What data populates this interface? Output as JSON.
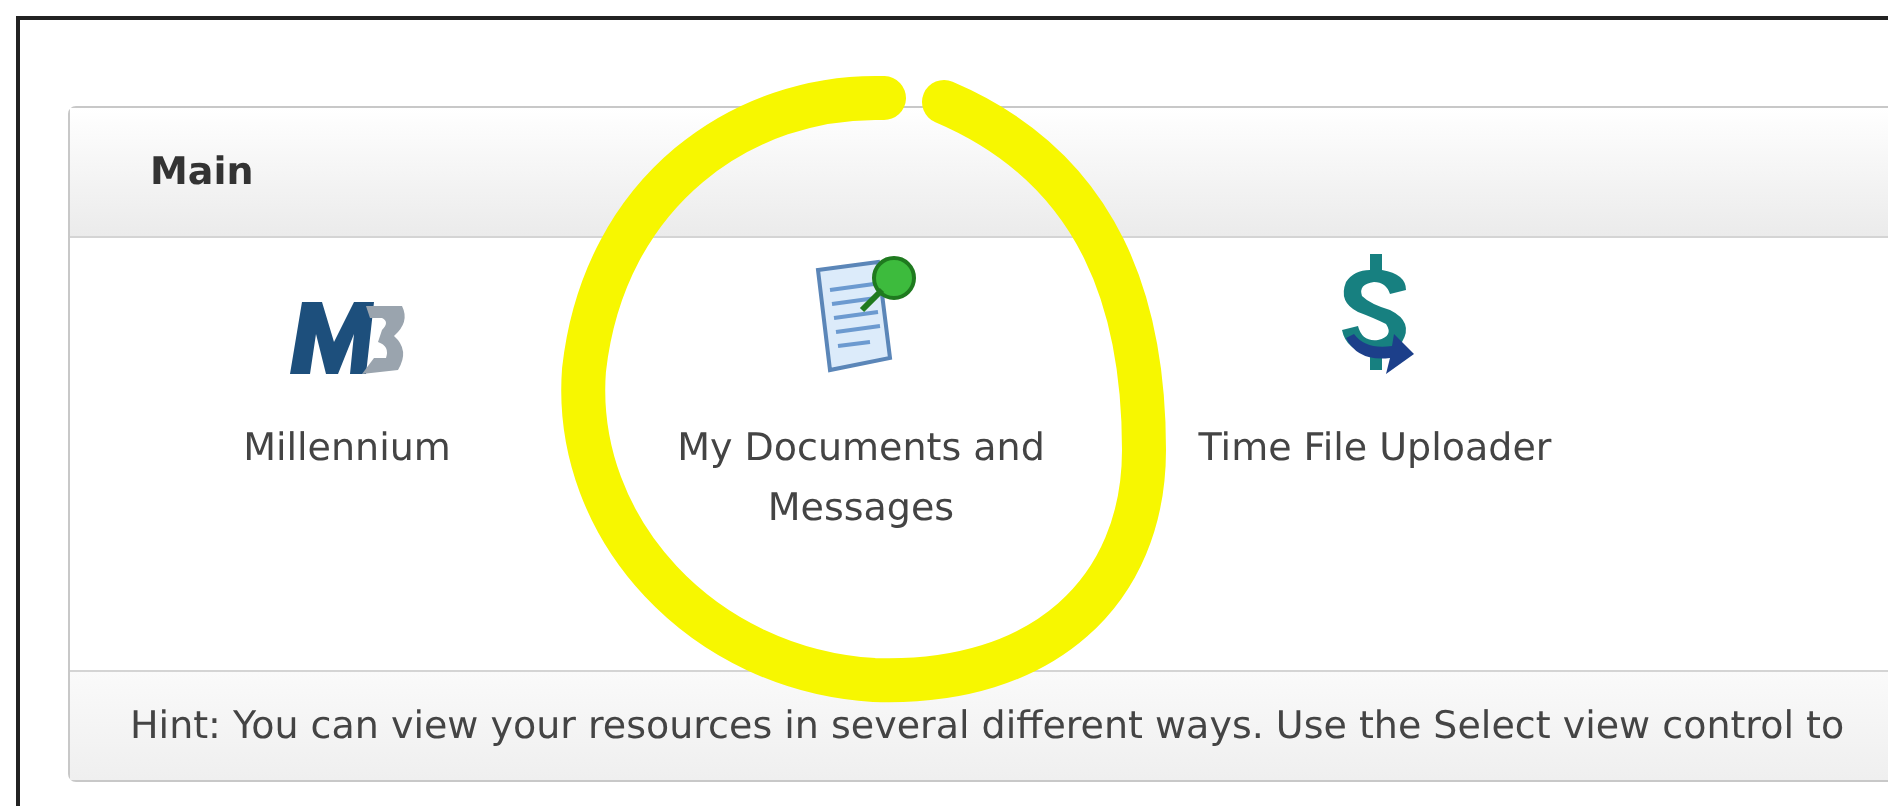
{
  "panel": {
    "title": "Main",
    "items": [
      {
        "label": "Millennium"
      },
      {
        "label": "My Documents and Messages"
      },
      {
        "label": "Time File Uploader"
      }
    ],
    "hint": "Hint: You can view your resources in several different ways. Use the Select view control to"
  }
}
